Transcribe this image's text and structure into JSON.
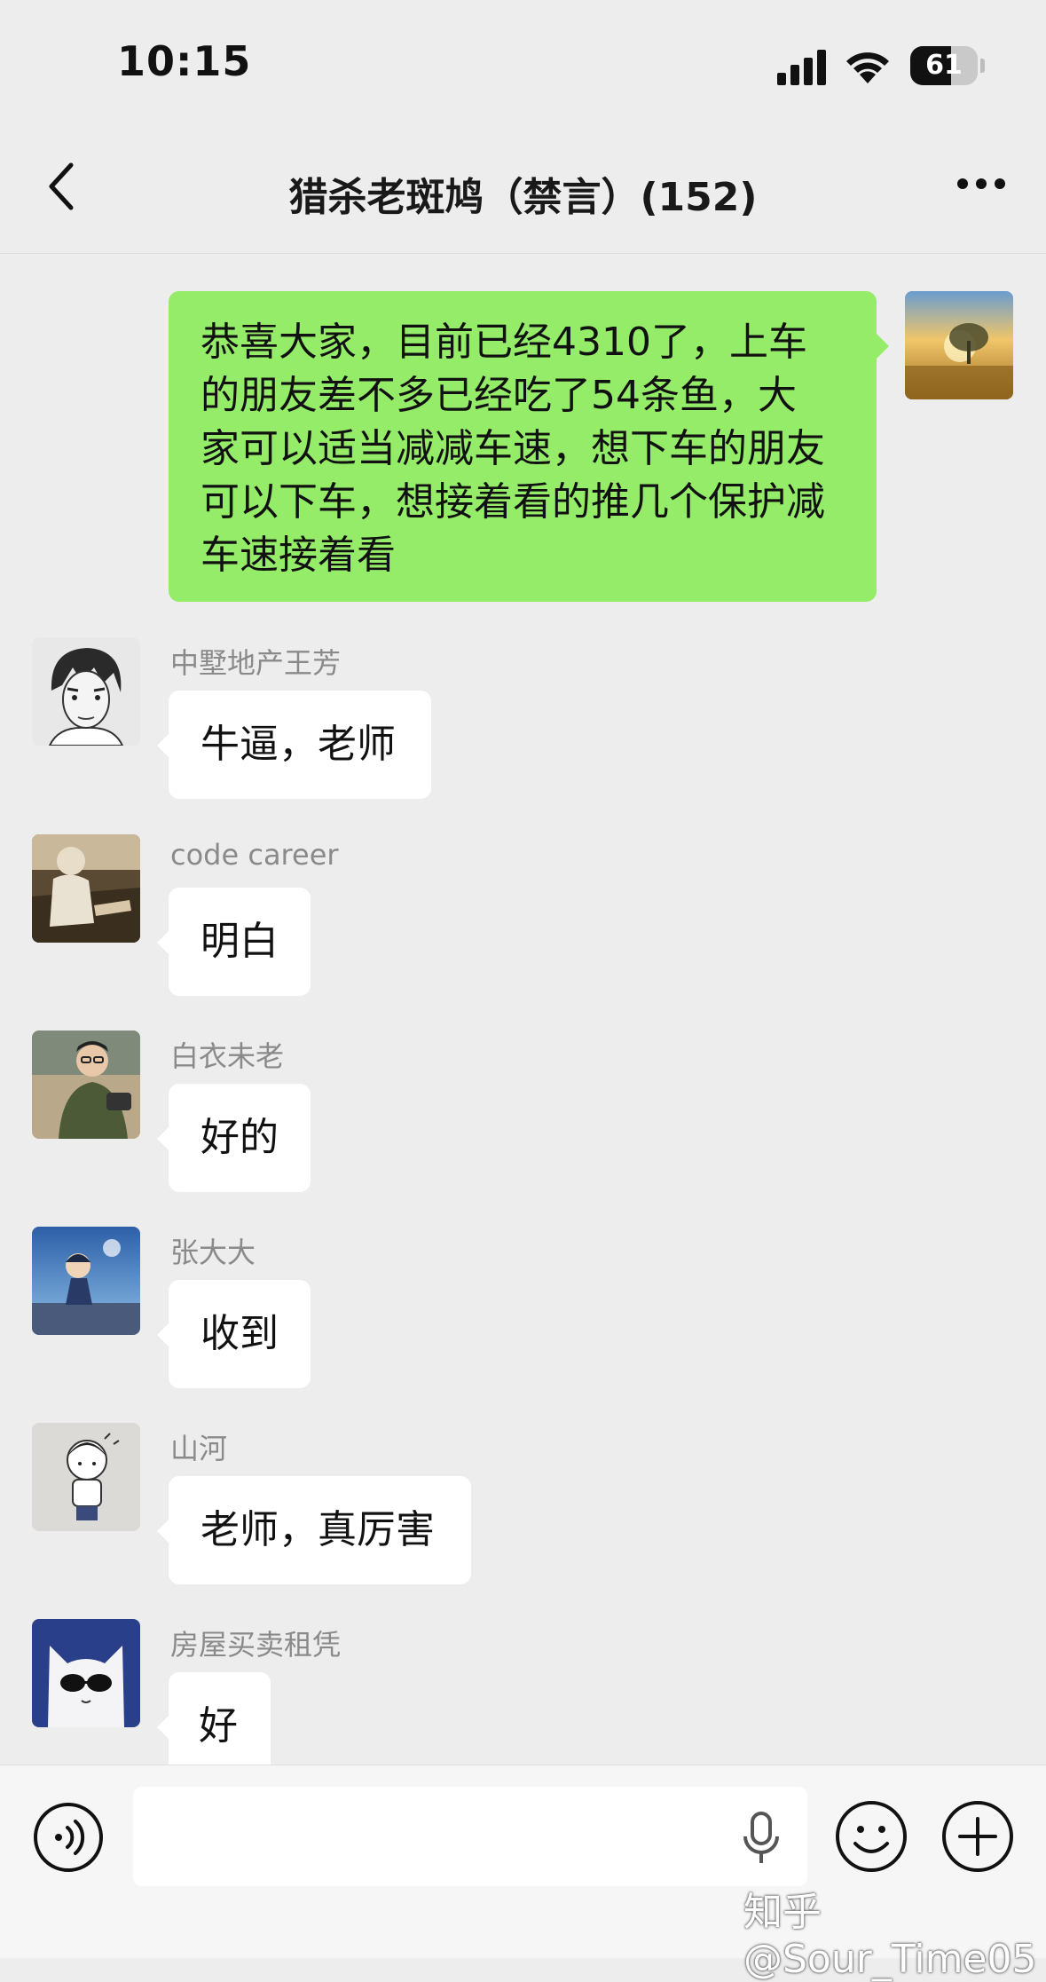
{
  "status_bar": {
    "time": "10:15",
    "battery_percent": "61",
    "battery_level": 0.61
  },
  "nav": {
    "title": "猎杀老斑鸠（禁言）(152)"
  },
  "messages": [
    {
      "side": "self",
      "sender": "",
      "lines": [
        "恭喜大家，目前已经4310了，上车",
        "的朋友差不多已经吃了54条鱼，大",
        "家可以适当减减车速，想下车的朋友",
        "可以下车，想接着看的推几个保护减",
        "车速接着看"
      ]
    },
    {
      "side": "other",
      "sender": "中墅地产王芳",
      "text": "牛逼，老师"
    },
    {
      "side": "other",
      "sender": "code career",
      "text": "明白"
    },
    {
      "side": "other",
      "sender": "白衣未老",
      "text": "好的"
    },
    {
      "side": "other",
      "sender": "张大大",
      "text": "收到"
    },
    {
      "side": "other",
      "sender": "山河",
      "text": "老师，真厉害"
    },
    {
      "side": "other",
      "sender": "房屋买卖租凭",
      "text": "好"
    }
  ],
  "watermark": "知乎 @Sour_Time05",
  "colors": {
    "background": "#ededed",
    "self_bubble": "#95ec69",
    "other_bubble": "#ffffff",
    "sender_name": "#8a8a8a"
  },
  "icons": [
    "signal-icon",
    "wifi-icon",
    "battery-icon",
    "back-icon",
    "more-icon",
    "voice-icon",
    "mic-icon",
    "emoji-icon",
    "plus-icon"
  ]
}
